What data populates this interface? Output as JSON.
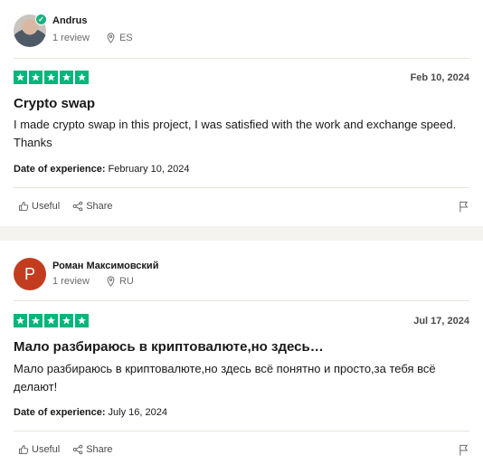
{
  "reviews": [
    {
      "name": "Andrus",
      "avatar_type": "photo",
      "verified": true,
      "review_count": "1 review",
      "country": "ES",
      "rating": 5,
      "date": "Feb 10, 2024",
      "title": "Crypto swap",
      "body": "I made crypto swap in this project, I was satisfied with the work and exchange speed. Thanks",
      "experience_label": "Date of experience:",
      "experience_date": "February 10, 2024",
      "useful_label": "Useful",
      "share_label": "Share"
    },
    {
      "name": "Роман Максимовский",
      "avatar_type": "letter",
      "avatar_letter": "P",
      "avatar_color": "#c23d1f",
      "verified": false,
      "review_count": "1 review",
      "country": "RU",
      "rating": 5,
      "date": "Jul 17, 2024",
      "title": "Мало разбираюсь в криптовалюте,но здесь…",
      "body": "Мало разбираюсь в криптовалюте,но здесь всё понятно и просто,за тебя всё делают!",
      "experience_label": "Date of experience:",
      "experience_date": "July 16, 2024",
      "useful_label": "Useful",
      "share_label": "Share"
    }
  ],
  "colors": {
    "star_green": "#00b67a",
    "verified_green": "#1ab180",
    "page_background": "#f4f3ef"
  },
  "icons": [
    "verified-check-icon",
    "location-pin-icon",
    "star-icon",
    "thumbs-up-icon",
    "share-icon",
    "flag-icon"
  ]
}
